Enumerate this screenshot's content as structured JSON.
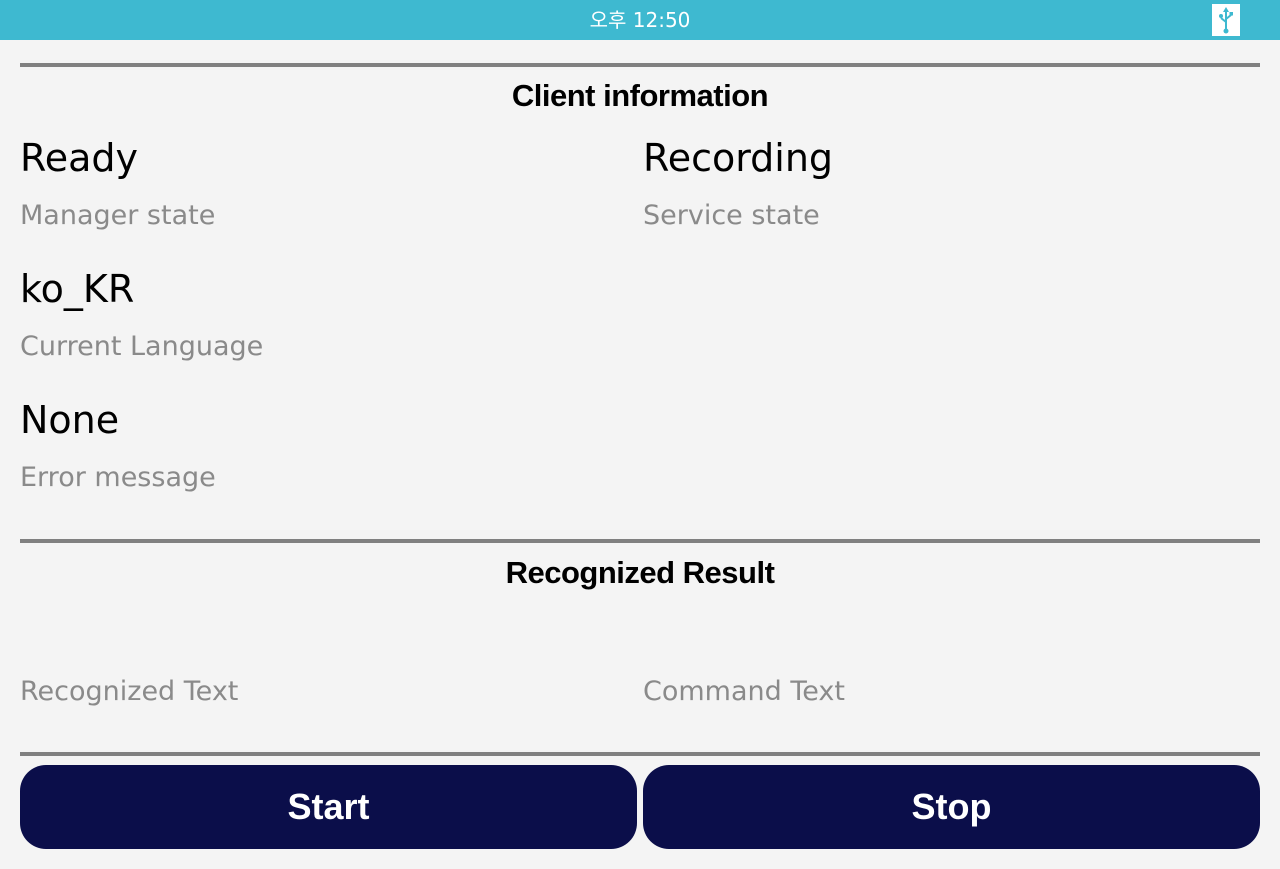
{
  "status_bar": {
    "time": "오후 12:50",
    "icon": "usb-icon",
    "color": "#3eb9d0"
  },
  "client_info": {
    "title": "Client information",
    "manager_state": {
      "value": "Ready",
      "label": "Manager state"
    },
    "service_state": {
      "value": "Recording",
      "label": "Service state"
    },
    "current_language": {
      "value": "ko_KR",
      "label": "Current Language"
    },
    "error_message": {
      "value": "None",
      "label": "Error message"
    }
  },
  "recognized_result": {
    "title": "Recognized Result",
    "recognized_text": {
      "value": "",
      "label": "Recognized Text"
    },
    "command_text": {
      "value": "",
      "label": "Command Text"
    }
  },
  "buttons": {
    "start_label": "Start",
    "stop_label": "Stop",
    "color": "#0b0e4a"
  }
}
